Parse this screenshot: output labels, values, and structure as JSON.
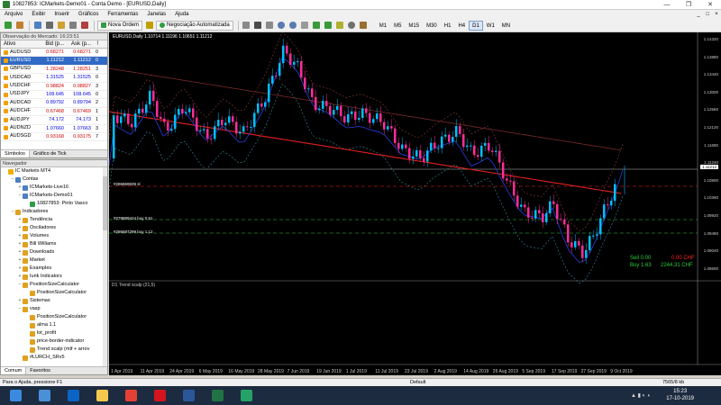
{
  "window": {
    "title": "10827853: ICMarkets-Demo01 - Conta Demo - [EURUSD,Daily]",
    "controls": [
      "—",
      "❐",
      "✕"
    ]
  },
  "menu": [
    "Arquivo",
    "Exibir",
    "Inserir",
    "Gráficos",
    "Ferramentas",
    "Janelas",
    "Ajuda"
  ],
  "mdi_controls": [
    "_",
    "□",
    "×"
  ],
  "toolbar": {
    "new_order": "Nova Ordem",
    "auto_trading": "Negociação Automatizada",
    "timeframes": [
      "M1",
      "M5",
      "M15",
      "M30",
      "H1",
      "H4",
      "D1",
      "W1",
      "MN"
    ],
    "active_timeframe": "D1"
  },
  "market_watch": {
    "header": "Observação do Mercado: 16:23:51",
    "columns": [
      "Ativo",
      "Bid (p...",
      "Ask (p...",
      "!"
    ],
    "rows": [
      {
        "symbol": "AUDUSD",
        "bid": "0.68271",
        "ask": "0.68271",
        "n": "0",
        "dir": "dn"
      },
      {
        "symbol": "EURUSD",
        "bid": "1.11212",
        "ask": "1.11212",
        "n": "0",
        "dir": "sel"
      },
      {
        "symbol": "GBPUSD",
        "bid": "1.28248",
        "ask": "1.28251",
        "n": "3",
        "dir": "dn"
      },
      {
        "symbol": "USDCAD",
        "bid": "1.31525",
        "ask": "1.31525",
        "n": "0",
        "dir": "up"
      },
      {
        "symbol": "USDCHF",
        "bid": "0.98824",
        "ask": "0.98827",
        "n": "3",
        "dir": "dn"
      },
      {
        "symbol": "USDJPY",
        "bid": "108.645",
        "ask": "108.645",
        "n": "0",
        "dir": "up"
      },
      {
        "symbol": "AUDCAD",
        "bid": "0.89792",
        "ask": "0.89794",
        "n": "2",
        "dir": "up"
      },
      {
        "symbol": "AUDCHF",
        "bid": "0.67468",
        "ask": "0.67469",
        "n": "1",
        "dir": "dn"
      },
      {
        "symbol": "AUDJPY",
        "bid": "74.172",
        "ask": "74.173",
        "n": "1",
        "dir": "up"
      },
      {
        "symbol": "AUDNZD",
        "bid": "1.07660",
        "ask": "1.07663",
        "n": "3",
        "dir": "up"
      },
      {
        "symbol": "AUDSGD",
        "bid": "0.93168",
        "ask": "0.93175",
        "n": "7",
        "dir": "dn"
      }
    ],
    "tabs": [
      "Símbolos",
      "Gráfico de Tick"
    ]
  },
  "navigator": {
    "header": "Navegador",
    "items": [
      {
        "label": "IC Markets MT4",
        "level": 0,
        "toggle": "",
        "icon": "#f0b000"
      },
      {
        "label": "Contas",
        "level": 1,
        "toggle": "−",
        "icon": "#4a7fc1"
      },
      {
        "label": "ICMarkets-Live16",
        "level": 2,
        "toggle": "+",
        "icon": "#4a7fc1"
      },
      {
        "label": "ICMarkets-Demo01",
        "level": 2,
        "toggle": "−",
        "icon": "#4a7fc1"
      },
      {
        "label": "10827853: Pinto Vasco",
        "level": 3,
        "toggle": "",
        "icon": "#2e9e44"
      },
      {
        "label": "Indicadores",
        "level": 1,
        "toggle": "−",
        "icon": "#e0a020"
      },
      {
        "label": "Tendência",
        "level": 2,
        "toggle": "+",
        "icon": "#e0a020"
      },
      {
        "label": "Osciladores",
        "level": 2,
        "toggle": "+",
        "icon": "#e0a020"
      },
      {
        "label": "Volumes",
        "level": 2,
        "toggle": "+",
        "icon": "#e0a020"
      },
      {
        "label": "Bill Williams",
        "level": 2,
        "toggle": "+",
        "icon": "#e0a020"
      },
      {
        "label": "Downloads",
        "level": 2,
        "toggle": "+",
        "icon": "#e0a020"
      },
      {
        "label": "Market",
        "level": 2,
        "toggle": "+",
        "icon": "#e0a020"
      },
      {
        "label": "Examples",
        "level": 2,
        "toggle": "+",
        "icon": "#e0a020"
      },
      {
        "label": "Iurik Indicators",
        "level": 2,
        "toggle": "+",
        "icon": "#e0a020"
      },
      {
        "label": "PositionSizeCalculator",
        "level": 2,
        "toggle": "−",
        "icon": "#e0a020"
      },
      {
        "label": "PositionSizeCalculator",
        "level": 3,
        "toggle": "",
        "icon": "#e0a020"
      },
      {
        "label": "Sistemas",
        "level": 2,
        "toggle": "+",
        "icon": "#e0a020"
      },
      {
        "label": "vasp",
        "level": 2,
        "toggle": "−",
        "icon": "#e0a020"
      },
      {
        "label": "PositionSizeCalculator",
        "level": 3,
        "toggle": "",
        "icon": "#e0a020"
      },
      {
        "label": "alma 1.1",
        "level": 3,
        "toggle": "",
        "icon": "#e0a020"
      },
      {
        "label": "lot_profit",
        "level": 3,
        "toggle": "",
        "icon": "#e0a020"
      },
      {
        "label": "price-border-indicator",
        "level": 3,
        "toggle": "",
        "icon": "#e0a020"
      },
      {
        "label": "Trend scalp (mtf + arrov",
        "level": 3,
        "toggle": "",
        "icon": "#e0a020"
      },
      {
        "label": "#LURCH_SRv5",
        "level": 2,
        "toggle": "",
        "icon": "#e0a020"
      }
    ],
    "tabs": [
      "Comum",
      "Favoritos"
    ]
  },
  "chart": {
    "title": "EURUSD,Daily  1.10714 1.11196 1.10651 1.11212",
    "indicator_title": "D1 Trend scalp (21,5)",
    "price_labels": [
      "1.14320",
      "1.13880",
      "1.13440",
      "1.13000",
      "1.12560",
      "1.12120",
      "1.11680",
      "1.11240",
      "1.10800",
      "1.10360",
      "1.09920",
      "1.09480",
      "1.09040",
      "1.08600"
    ],
    "current_price": "1.11212",
    "date_labels": [
      "1 Apr 2019",
      "11 Apr 2019",
      "24 Apr 2019",
      "6 May 2019",
      "16 May 2019",
      "28 May 2019",
      "7 Jun 2019",
      "19 Jun 2019",
      "1 Jul 2019",
      "11 Jul 2019",
      "23 Jul 2019",
      "2 Aug 2019",
      "14 Aug 2019",
      "26 Aug 2019",
      "5 Sep 2019",
      "17 Sep 2019",
      "27 Sep 2019",
      "9 Oct 2019"
    ],
    "order_labels": [
      {
        "text": "#286869839 sl",
        "color": "#ff4040"
      },
      {
        "text": "#286687299 buy 1.12",
        "color": "#ffffff"
      },
      {
        "text": "#278889424 buy 0.51",
        "color": "#ffffff"
      }
    ],
    "sell_label": "Sell 0.00",
    "sell_value": "0.00 CHF",
    "buy_label": "Buy 1.63",
    "buy_value": "2244.31 CHF",
    "colors": {
      "bull": "#00bfff",
      "bear": "#ff2d9a",
      "ma_red": "#e02020",
      "ma_blue": "#2b3de0",
      "bands": "#3aa",
      "trade_green": "#2ecc40",
      "trade_red": "#ff2020"
    }
  },
  "status": {
    "help": "Para o Ajuda, pressione F1",
    "profile": "Default",
    "traffic": "7565/8 kb"
  },
  "taskbar": {
    "time": "15:23",
    "date": "17-10-2019",
    "apps": [
      {
        "name": "start",
        "color": "#3a8be0"
      },
      {
        "name": "files",
        "color": "#4a90d9"
      },
      {
        "name": "outlook",
        "color": "#0b63c4"
      },
      {
        "name": "explorer",
        "color": "#f2c94c"
      },
      {
        "name": "chrome",
        "color": "#e44134"
      },
      {
        "name": "opera",
        "color": "#d4141e"
      },
      {
        "name": "word",
        "color": "#2b579a"
      },
      {
        "name": "excel",
        "color": "#217346"
      },
      {
        "name": "metatrader",
        "color": "#26a269"
      }
    ]
  }
}
